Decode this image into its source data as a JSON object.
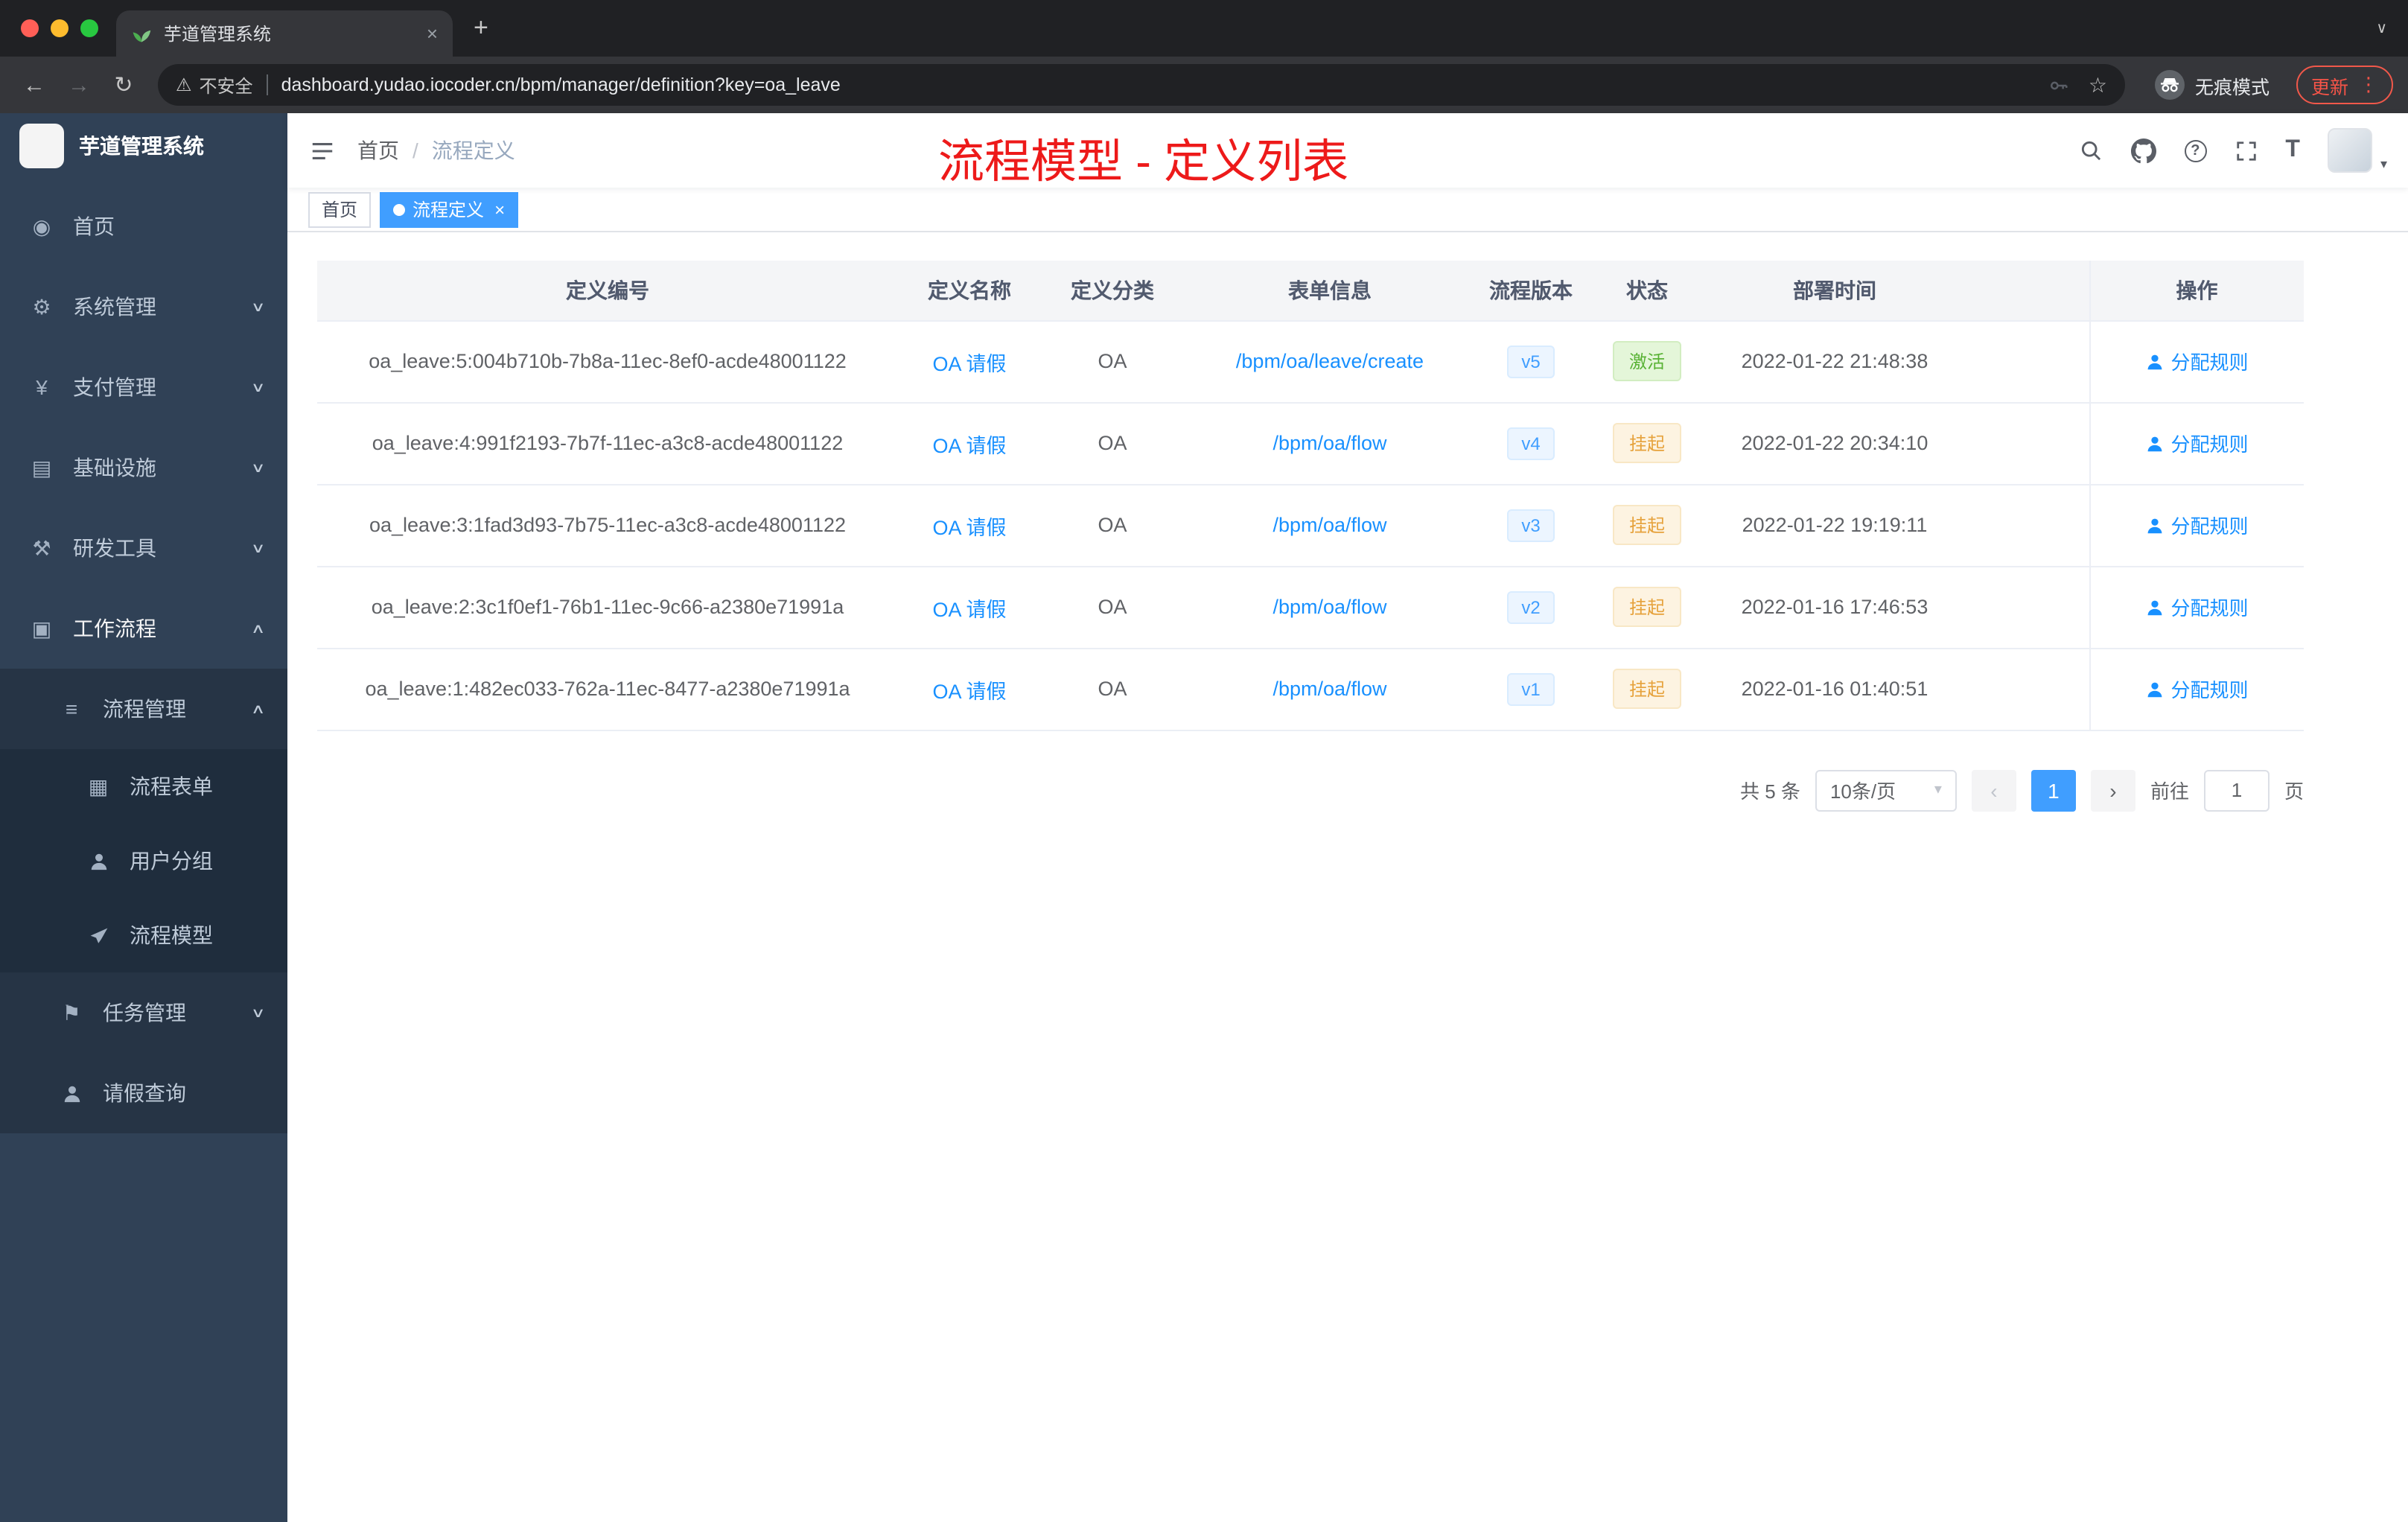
{
  "colors": {
    "accent": "#409eff",
    "link": "#1890ff",
    "success": "#58b234",
    "warning": "#e6a23c",
    "annotation_red": "#ed1a1a",
    "sidebar_bg": "#304156",
    "sidebar_sub_bg": "#263445",
    "sidebar_sub2_bg": "#1f2d3d",
    "browser_bg": "#202124",
    "toolbar_bg": "#35363a"
  },
  "icons": {
    "dashboard": "◉",
    "gear": "⚙",
    "yen": "¥",
    "infra": "▤",
    "tools": "⚒",
    "workflow": "▣",
    "list": "≡",
    "doc": "▦",
    "flag": "⚑",
    "question": "?",
    "font": "T",
    "star": "☆",
    "warning": "⚠",
    "back": "←",
    "forward": "→",
    "reload": "↻",
    "more": "⋮",
    "close": "×",
    "plus": "+",
    "chev_down": "∨",
    "chev_up": "∧",
    "caret_down": "▾",
    "page_prev": "‹",
    "page_next": "›"
  },
  "browser": {
    "tab_title": "芋道管理系统",
    "security_label": "不安全",
    "url": "dashboard.yudao.iocoder.cn/bpm/manager/definition?key=oa_leave",
    "incognito_label": "无痕模式",
    "update_label": "更新"
  },
  "sidebar": {
    "logo_title": "芋道管理系统",
    "items": [
      {
        "label": "首页",
        "icon": "dashboard-icon"
      },
      {
        "label": "系统管理",
        "icon": "gear-icon"
      },
      {
        "label": "支付管理",
        "icon": "yen-icon"
      },
      {
        "label": "基础设施",
        "icon": "infra-icon"
      },
      {
        "label": "研发工具",
        "icon": "tools-icon"
      },
      {
        "label": "工作流程",
        "icon": "workflow-icon"
      }
    ],
    "workflow": {
      "process_mgmt": "流程管理",
      "process_children": [
        "流程表单",
        "用户分组",
        "流程模型"
      ],
      "task_mgmt": "任务管理",
      "leave_query": "请假查询"
    }
  },
  "header": {
    "breadcrumb_home": "首页",
    "breadcrumb_sep": "/",
    "breadcrumb_current": "流程定义",
    "annotation": "流程模型 - 定义列表"
  },
  "tags": {
    "home": "首页",
    "current": "流程定义"
  },
  "table": {
    "columns": [
      "定义编号",
      "定义名称",
      "定义分类",
      "表单信息",
      "流程版本",
      "状态",
      "部署时间",
      "操作"
    ],
    "rows": [
      {
        "id": "oa_leave:5:004b710b-7b8a-11ec-8ef0-acde48001122",
        "name": "OA 请假",
        "category": "OA",
        "form": "/bpm/oa/leave/create",
        "version": "v5",
        "status": "激活",
        "status_type": "success",
        "time": "2022-01-22 21:48:38",
        "action": "分配规则"
      },
      {
        "id": "oa_leave:4:991f2193-7b7f-11ec-a3c8-acde48001122",
        "name": "OA 请假",
        "category": "OA",
        "form": "/bpm/oa/flow",
        "version": "v4",
        "status": "挂起",
        "status_type": "warning",
        "time": "2022-01-22 20:34:10",
        "action": "分配规则"
      },
      {
        "id": "oa_leave:3:1fad3d93-7b75-11ec-a3c8-acde48001122",
        "name": "OA 请假",
        "category": "OA",
        "form": "/bpm/oa/flow",
        "version": "v3",
        "status": "挂起",
        "status_type": "warning",
        "time": "2022-01-22 19:19:11",
        "action": "分配规则"
      },
      {
        "id": "oa_leave:2:3c1f0ef1-76b1-11ec-9c66-a2380e71991a",
        "name": "OA 请假",
        "category": "OA",
        "form": "/bpm/oa/flow",
        "version": "v2",
        "status": "挂起",
        "status_type": "warning",
        "time": "2022-01-16 17:46:53",
        "action": "分配规则"
      },
      {
        "id": "oa_leave:1:482ec033-762a-11ec-8477-a2380e71991a",
        "name": "OA 请假",
        "category": "OA",
        "form": "/bpm/oa/flow",
        "version": "v1",
        "status": "挂起",
        "status_type": "warning",
        "time": "2022-01-16 01:40:51",
        "action": "分配规则"
      }
    ]
  },
  "pagination": {
    "total": "共 5 条",
    "page_size": "10条/页",
    "current_page": "1",
    "goto_label": "前往",
    "goto_value": "1",
    "page_unit": "页"
  }
}
